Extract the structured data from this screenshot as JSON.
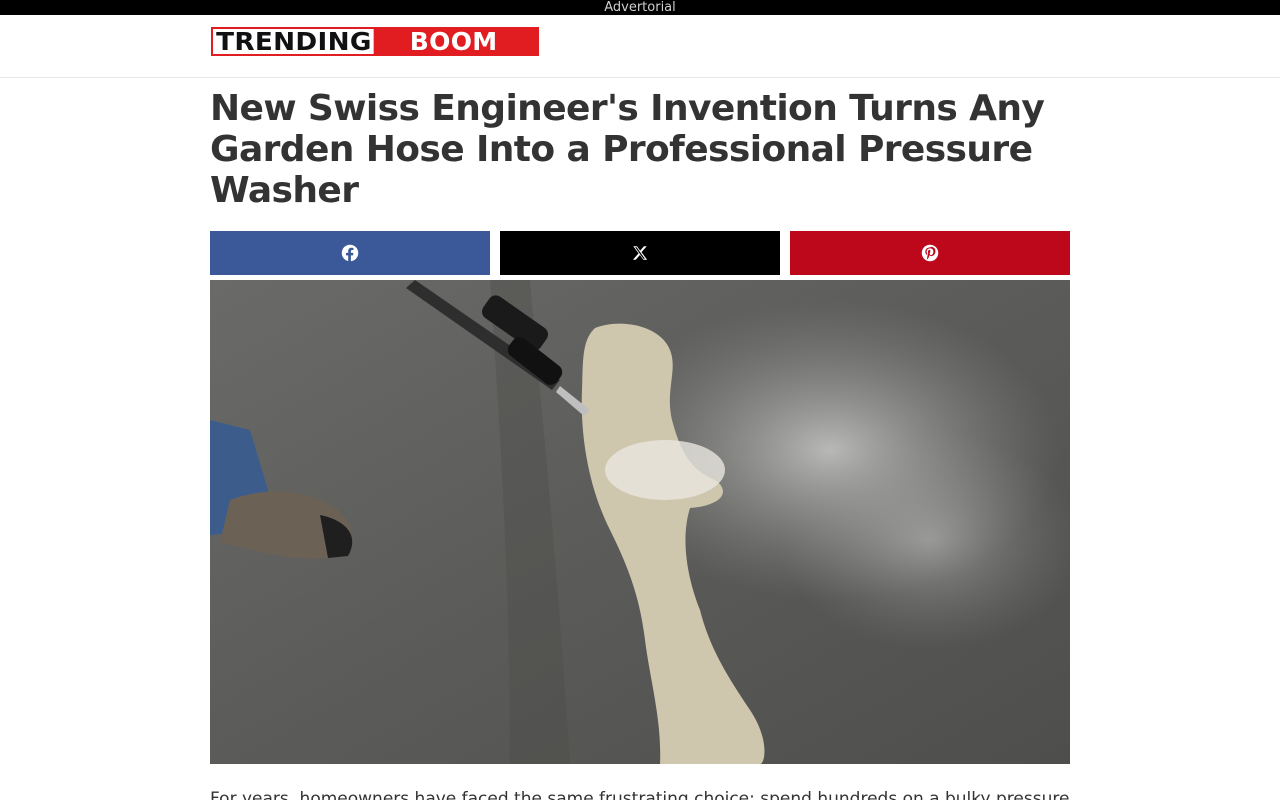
{
  "ad_bar": {
    "label": "Advertorial"
  },
  "logo": {
    "part1": "TRENDING",
    "part2": "BOOM",
    "accent_color": "#e11d21"
  },
  "article": {
    "headline": "New Swiss Engineer's Invention Turns Any Garden Hose Into a Professional Pressure Washer",
    "body_preview": "For years, homeowners have faced the same frustrating choice: spend hundreds on a bulky pressure"
  },
  "share": [
    {
      "network": "facebook",
      "icon": "facebook-icon",
      "color": "#3b5998"
    },
    {
      "network": "x",
      "icon": "x-icon",
      "color": "#000000"
    },
    {
      "network": "pinterest",
      "icon": "pinterest-icon",
      "color": "#bd081c"
    }
  ],
  "hero_image": {
    "subject": "pressure-washer-cleaning-concrete"
  }
}
